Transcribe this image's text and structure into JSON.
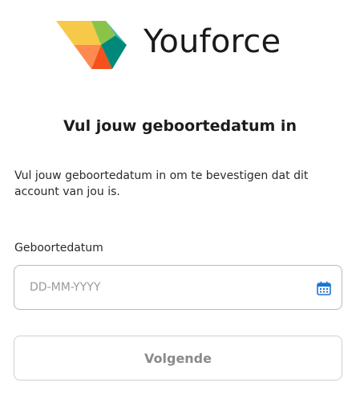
{
  "brand": {
    "name": "Youforce",
    "logo_icon": "youforce-logo-icon",
    "colors": [
      "#f7c948",
      "#7cb342",
      "#4db6ac",
      "#00897b",
      "#ff7043",
      "#f4511e"
    ]
  },
  "page": {
    "title": "Vul jouw geboortedatum in",
    "description": "Vul jouw geboortedatum in om te bevestigen dat dit account van jou is."
  },
  "form": {
    "birthdate_label": "Geboortedatum",
    "birthdate_placeholder": "DD-MM-YYYY",
    "birthdate_value": "",
    "calendar_icon": "calendar-icon",
    "calendar_icon_color": "#1976d2",
    "next_label": "Volgende"
  }
}
